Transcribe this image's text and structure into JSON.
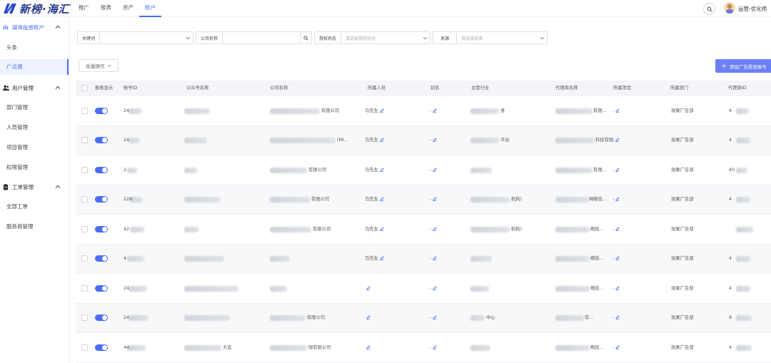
{
  "app": {
    "logo_text": "新榜·海汇"
  },
  "nav": {
    "items": [
      "推广",
      "报表",
      "资产",
      "账户"
    ],
    "active_index": 3
  },
  "header": {
    "user_name": "运营-优化师"
  },
  "sidebar": {
    "groups": [
      {
        "label": "媒体投放账户",
        "icon": "media-icon",
        "expanded": true,
        "items": [
          "头条",
          "广点通"
        ],
        "active_item": 1
      },
      {
        "label": "用户管理",
        "icon": "users-icon",
        "expanded": true,
        "items": [
          "部门管理",
          "人员管理",
          "项目管理",
          "权限管理"
        ]
      },
      {
        "label": "工单管理",
        "icon": "ticket-icon",
        "expanded": true,
        "items": [
          "全部工单",
          "服务商管理"
        ]
      }
    ]
  },
  "filters": {
    "keyword": {
      "label": "关键词",
      "placeholder": ""
    },
    "company": {
      "label": "公司名称",
      "placeholder": ""
    },
    "auth_status": {
      "label": "授权状态",
      "placeholder": "请选择授权状态"
    },
    "source": {
      "label": "来源",
      "placeholder": "请选择来源"
    }
  },
  "toolbar": {
    "bulk_label": "批量操作",
    "add_label": "添加广告投放账号"
  },
  "table": {
    "columns": [
      "报表显示",
      "账号ID",
      "公众号名称",
      "公司名称",
      "所属人员",
      "别名",
      "主营行业",
      "代理商名称",
      "所属项目",
      "所属部门",
      "代理商ID"
    ],
    "rows": [
      {
        "account_id": "24",
        "wechat_name": "",
        "company": "有限公司",
        "owner": "马先生",
        "alias": "-",
        "industry": "食",
        "agency": "有限...",
        "project": "-",
        "dept": "效果广告部",
        "agency_id": "4"
      },
      {
        "account_id": "24",
        "wechat_name": "",
        "company": "(MI...",
        "owner": "马先生",
        "alias": "-",
        "industry": "平台",
        "agency": "科技有限...",
        "project": "-",
        "dept": "效果广告部",
        "agency_id": "4"
      },
      {
        "account_id": "2",
        "wechat_name": "",
        "company": "有限公司",
        "owner": "马先生",
        "alias": "-",
        "industry": "",
        "agency": "有限...",
        "project": "-",
        "dept": "效果广告部",
        "agency_id": "40"
      },
      {
        "account_id": "228",
        "wechat_name": "",
        "company": "有限公司",
        "owner": "马先生",
        "alias": "-",
        "industry": "机构)",
        "agency": "网络技...",
        "project": "-",
        "dept": "效果广告部",
        "agency_id": "4"
      },
      {
        "account_id": "42",
        "wechat_name": "",
        "company": "有限公司",
        "owner": "马先生",
        "alias": "-",
        "industry": "机构)",
        "agency": "络技...",
        "project": "-",
        "dept": "效果广告部",
        "agency_id": ""
      },
      {
        "account_id": "4",
        "wechat_name": "",
        "company": "",
        "owner": "马先生",
        "alias": "-",
        "industry": "",
        "agency": "络技...",
        "project": "-",
        "dept": "效果广告部",
        "agency_id": "4"
      },
      {
        "account_id": "24",
        "wechat_name": "",
        "company": "",
        "owner": "",
        "alias": "-",
        "industry": "",
        "agency": "络技...",
        "project": "-",
        "dept": "效果广告部",
        "agency_id": "4"
      },
      {
        "account_id": "24",
        "wechat_name": "",
        "company": "有限公司",
        "owner": "",
        "alias": "-",
        "industry": "中心",
        "agency": "有...",
        "project": "-",
        "dept": "效果广告部",
        "agency_id": "8"
      },
      {
        "account_id": "44",
        "wechat_name": "大会",
        "company": "限有限公司",
        "owner": "",
        "alias": "-",
        "industry": "",
        "agency": "络技...",
        "project": "-",
        "dept": "效果广告部",
        "agency_id": "4"
      }
    ]
  }
}
